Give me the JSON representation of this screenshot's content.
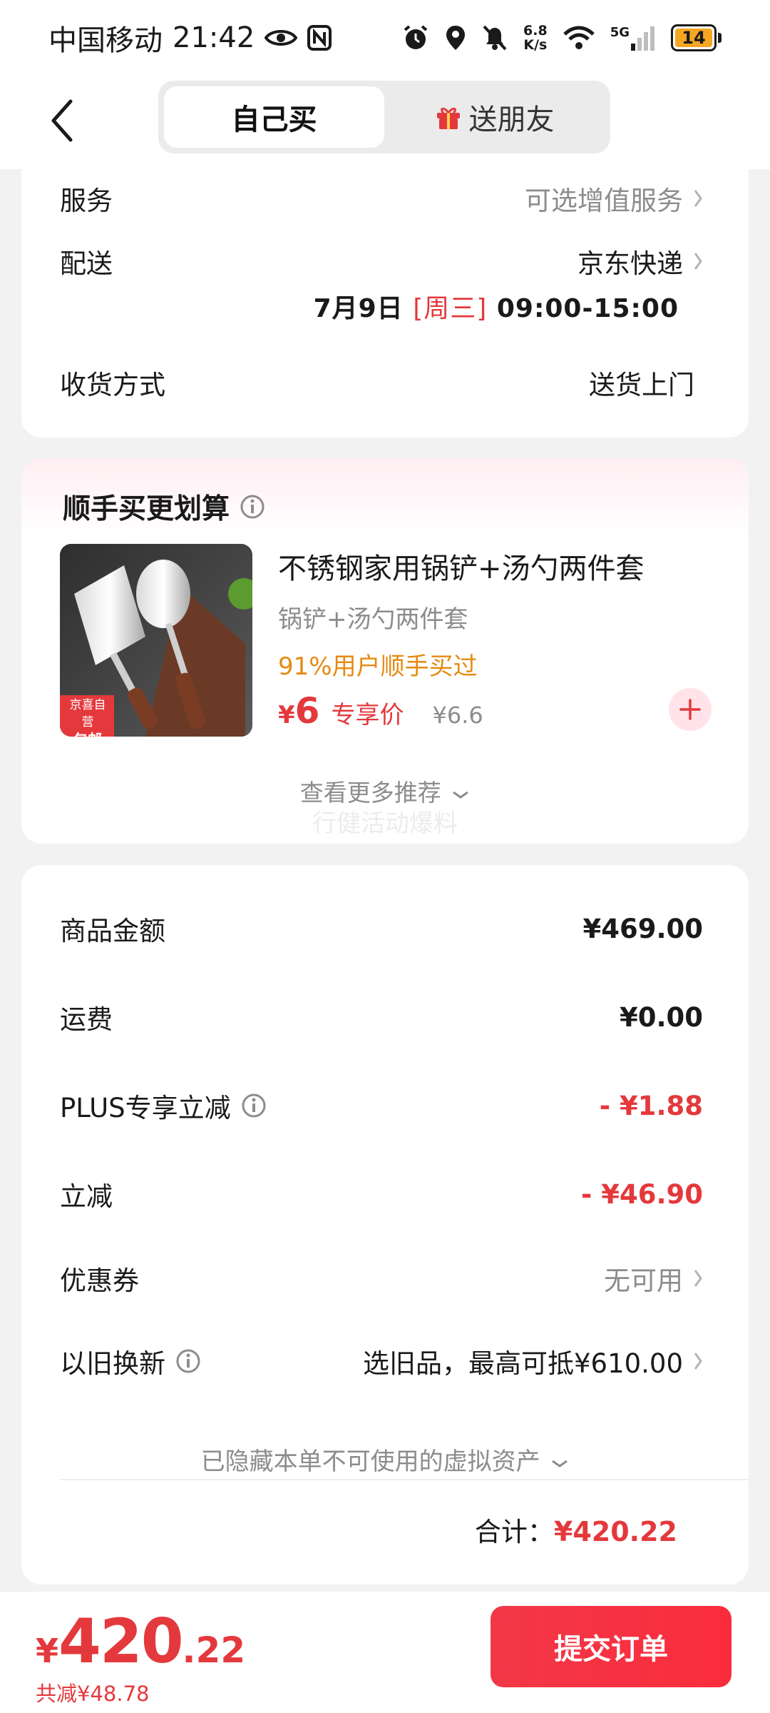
{
  "status_bar": {
    "carrier": "中国移动",
    "time": "21:42",
    "net_speed_value": "6.8",
    "net_speed_unit": "K/s",
    "network_type": "5G",
    "battery": "14"
  },
  "header": {
    "tabs": [
      {
        "label": "自己买",
        "active": true
      },
      {
        "label": "送朋友",
        "active": false
      }
    ]
  },
  "order_info": {
    "service": {
      "label": "服务",
      "value": "可选增值服务"
    },
    "delivery": {
      "label": "配送",
      "value": "京东快递",
      "date": "7月9日",
      "weekday": "[周三]",
      "time_range": "09:00-15:00"
    },
    "receive_method": {
      "label": "收货方式",
      "value": "送货上门"
    }
  },
  "recommend": {
    "title": "顺手买更划算",
    "product": {
      "name": "不锈钢家用锅铲+汤勺两件套",
      "subtitle": "锅铲+汤勺两件套",
      "bought_rate": "91%用户顺手买过",
      "currency": "¥",
      "price": "6",
      "price_tag": "专享价",
      "original_price": "¥6.6",
      "badge_top": "京喜自营",
      "badge_bottom": "包邮"
    },
    "more_label": "查看更多推荐",
    "watermark": "行健活动爆料"
  },
  "summary": {
    "rows": [
      {
        "label": "商品金额",
        "value": "¥469.00"
      },
      {
        "label": "运费",
        "value": "¥0.00"
      },
      {
        "label": "PLUS专享立减",
        "value": "- ¥1.88"
      },
      {
        "label": "立减",
        "value": "- ¥46.90"
      },
      {
        "label": "优惠券",
        "value": "无可用"
      },
      {
        "label": "以旧换新",
        "value": "选旧品，最高可抵¥610.00"
      }
    ],
    "hidden_assets": "已隐藏本单不可使用的虚拟资产",
    "total_label": "合计：",
    "total_value": "¥420.22"
  },
  "bottom_bar": {
    "currency": "¥",
    "price_int": "420",
    "price_dec": ".22",
    "saved": "共减¥48.78",
    "submit_label": "提交订单"
  },
  "colors": {
    "accent_red": "#e4393c",
    "orange": "#e58a12",
    "background": "#f2f2f2"
  }
}
